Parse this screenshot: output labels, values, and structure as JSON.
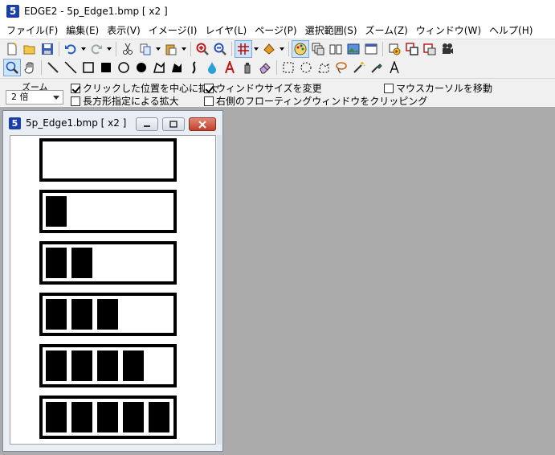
{
  "app": {
    "title": "EDGE2 - 5p_Edge1.bmp [ x2 ]",
    "icon_letter": "5"
  },
  "menu": [
    "ファイル(F)",
    "編集(E)",
    "表示(V)",
    "イメージ(I)",
    "レイヤ(L)",
    "ページ(P)",
    "選択範囲(S)",
    "ズーム(Z)",
    "ウィンドウ(W)",
    "ヘルプ(H)"
  ],
  "toolbar1_icons": [
    "new-file-icon",
    "open-folder-icon",
    "save-icon",
    "undo-icon",
    "redo-icon",
    "cut-icon",
    "copy-icon",
    "paste-icon",
    "zoom-in-icon",
    "zoom-out-icon",
    "grid-icon",
    "fill-bucket-icon",
    "palette-icon",
    "layers-icon",
    "pages-icon",
    "image-icon",
    "window-icon",
    "animation-icon",
    "frame-icon",
    "mask-icon",
    "camera-icon"
  ],
  "toolbar2_icons": [
    "zoom-tool-icon",
    "hand-tool-icon",
    "pen-icon",
    "line-icon",
    "rectangle-icon",
    "filled-rectangle-icon",
    "circle-icon",
    "filled-circle-icon",
    "polygon-icon",
    "filled-polygon-icon",
    "curve-icon",
    "drop-fill-icon",
    "text-icon",
    "spray-icon",
    "eraser-icon",
    "rect-select-icon",
    "ellipse-select-icon",
    "polygon-select-icon",
    "lasso-select-icon",
    "magic-wand-icon",
    "eyedropper-icon",
    "text-tool-icon"
  ],
  "options": {
    "zoom_label": "ズーム",
    "zoom_value": "2 倍",
    "click_center": "クリックした位置を中心に拡大",
    "click_center_checked": true,
    "rect_zoom": "長方形指定による拡大",
    "rect_zoom_checked": false,
    "window_resize": "ウィンドウサイズを変更",
    "window_resize_checked": true,
    "clip_floating": "右側のフローティングウィンドウをクリッピング",
    "clip_floating_checked": false,
    "move_cursor": "マウスカーソルを移動",
    "move_cursor_checked": false
  },
  "child_window": {
    "title": "5p_Edge1.bmp [ x2 ]",
    "icon_letter": "5",
    "frames_filled": [
      0,
      1,
      2,
      3,
      4,
      5
    ],
    "total_slots": 5
  },
  "colors": {
    "workspace": "#ababab",
    "accent_blue": "#1a3fa8"
  }
}
